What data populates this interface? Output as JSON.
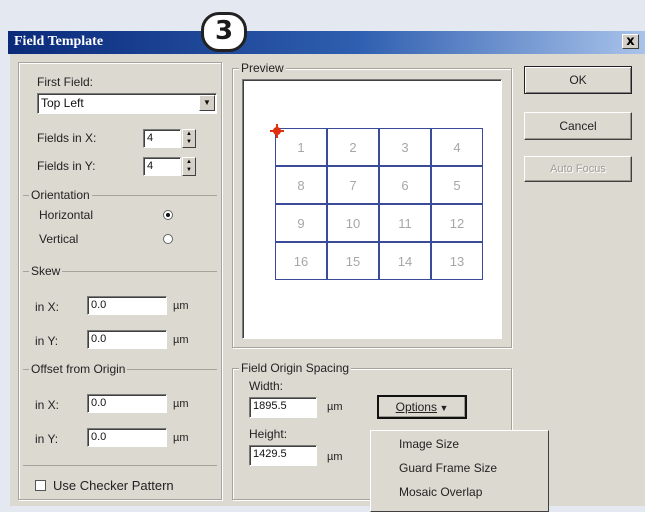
{
  "step_badge": "3",
  "window": {
    "title": "Field Template",
    "close_label": "x"
  },
  "first_field": {
    "label": "First Field:",
    "value": "Top Left",
    "fields_in_x_label": "Fields in X:",
    "fields_in_x_value": "4",
    "fields_in_y_label": "Fields in Y:",
    "fields_in_y_value": "4"
  },
  "orientation": {
    "label": "Orientation",
    "options": [
      {
        "label": "Horizontal",
        "selected": true
      },
      {
        "label": "Vertical",
        "selected": false
      }
    ]
  },
  "skew": {
    "label": "Skew",
    "x_label": "in X:",
    "x_value": "0.0",
    "x_unit": "µm",
    "y_label": "in Y:",
    "y_value": "0.0",
    "y_unit": "µm"
  },
  "offset": {
    "label": "Offset from Origin",
    "x_label": "in X:",
    "x_value": "0.0",
    "x_unit": "µm",
    "y_label": "in Y:",
    "y_value": "0.0",
    "y_unit": "µm"
  },
  "checker": {
    "label": "Use Checker Pattern",
    "checked": false
  },
  "preview": {
    "label": "Preview",
    "grid": [
      [
        "1",
        "2",
        "3",
        "4"
      ],
      [
        "8",
        "7",
        "6",
        "5"
      ],
      [
        "9",
        "10",
        "11",
        "12"
      ],
      [
        "16",
        "15",
        "14",
        "13"
      ]
    ]
  },
  "spacing": {
    "label": "Field Origin Spacing",
    "width_label": "Width:",
    "width_value": "1895.5",
    "width_unit": "µm",
    "height_label": "Height:",
    "height_value": "1429.5",
    "height_unit": "µm",
    "options_button": "Options"
  },
  "options_menu": [
    "Image Size",
    "Guard Frame Size",
    "Mosaic Overlap"
  ],
  "buttons": {
    "ok": "OK",
    "cancel": "Cancel",
    "auto_focus": "Auto Focus"
  },
  "colors": {
    "title_start": "#0b2a7a",
    "grid_line": "#3a4b9a",
    "origin_marker": "#e03010"
  }
}
